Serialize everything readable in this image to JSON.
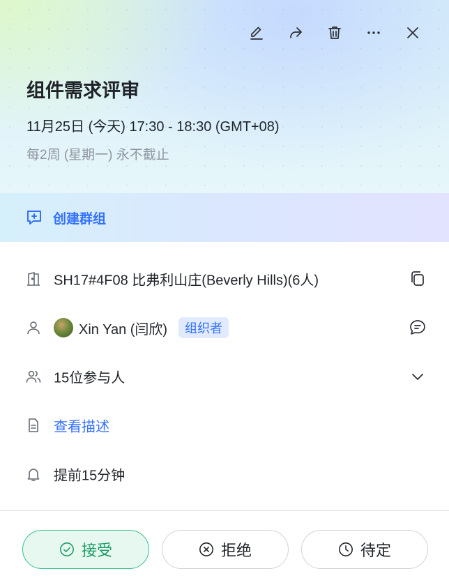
{
  "toolbar": {
    "icons": [
      "edit-icon",
      "share-icon",
      "delete-icon",
      "more-icon",
      "close-icon"
    ]
  },
  "event": {
    "title": "组件需求评审",
    "time": "11月25日 (今天) 17:30 - 18:30 (GMT+08)",
    "recurrence": "每2周 (星期一) 永不截止"
  },
  "group": {
    "label": "创建群组"
  },
  "location": {
    "text": "SH17#4F08 比弗利山庄(Beverly Hills)(6人)"
  },
  "organizer": {
    "name": "Xin Yan (闫欣)",
    "badge": "组织者"
  },
  "attendees": {
    "text": "15位参与人"
  },
  "description": {
    "link": "查看描述"
  },
  "reminder": {
    "text": "提前15分钟"
  },
  "actions": {
    "accept": "接受",
    "decline": "拒绝",
    "tentative": "待定"
  },
  "colors": {
    "accent": "#3370ff",
    "accept": "#1f9c68",
    "accept_bg": "#e6f8ef",
    "muted": "#8f959e"
  }
}
